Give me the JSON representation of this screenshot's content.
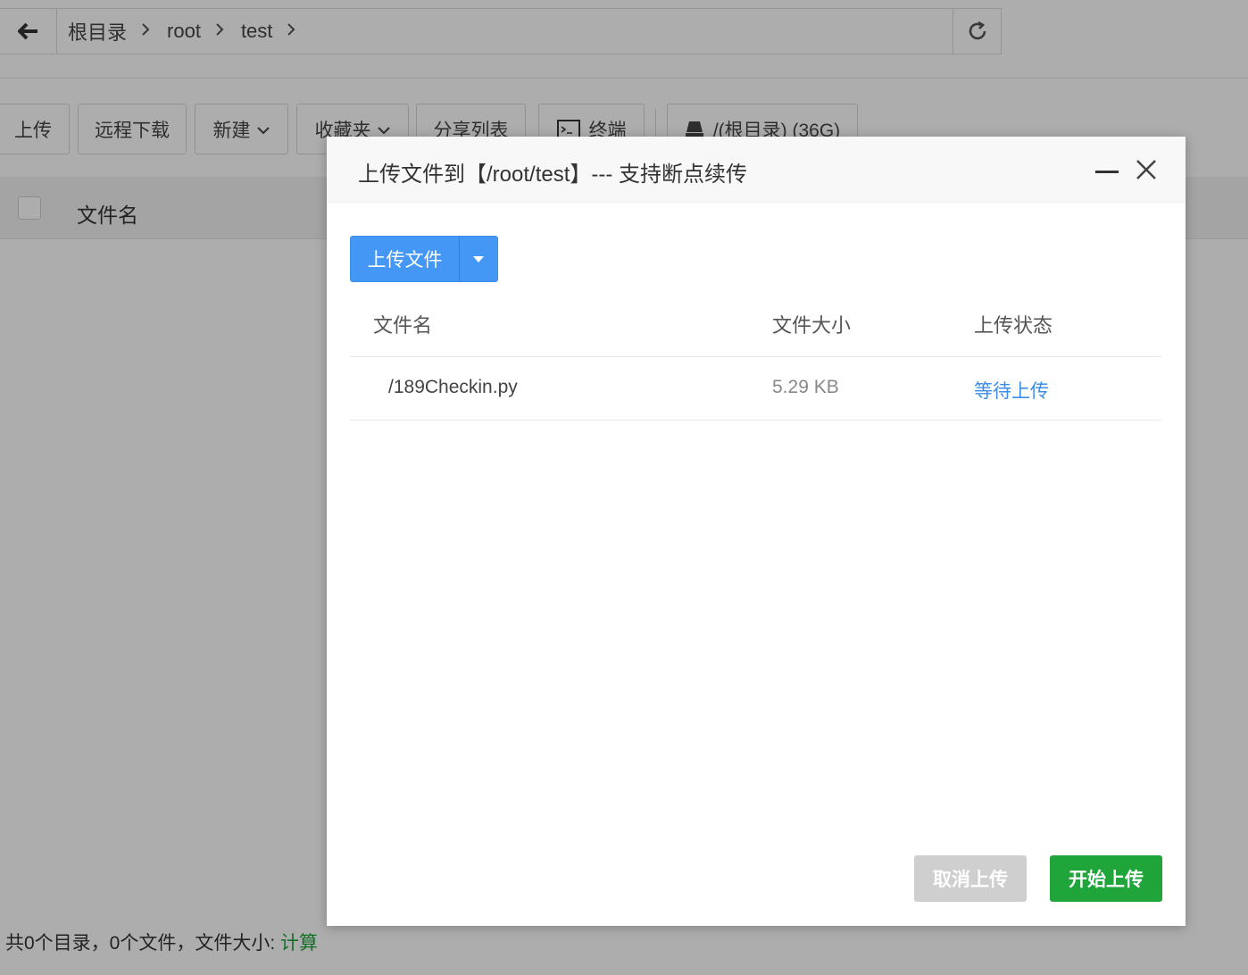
{
  "path_bar": {
    "breadcrumbs": [
      "根目录",
      "root",
      "test"
    ],
    "separator": ">"
  },
  "toolbar": {
    "upload": "上传",
    "remote_download": "远程下载",
    "new": "新建",
    "favorites": "收藏夹",
    "share_list": "分享列表",
    "terminal": "终端",
    "disk": "/(根目录) (36G)"
  },
  "file_table": {
    "header_name": "文件名"
  },
  "footer": {
    "stats": "共0个目录，0个文件，文件大小: ",
    "calc_link": "计算",
    "calc_color": "#20a53a"
  },
  "modal": {
    "title": "上传文件到【/root/test】--- 支持断点续传",
    "upload_button": "上传文件",
    "columns": [
      "文件名",
      "文件大小",
      "上传状态"
    ],
    "files": [
      {
        "name": "/189Checkin.py",
        "size": "5.29 KB",
        "status": "等待上传"
      }
    ],
    "cancel_button": "取消上传",
    "start_button": "开始上传",
    "accent_color": "#4597f5",
    "start_color": "#20a53a"
  }
}
